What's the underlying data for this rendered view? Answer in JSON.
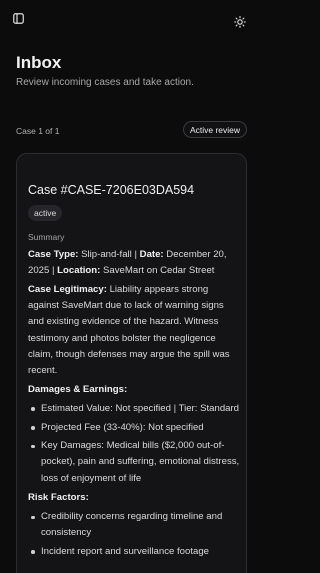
{
  "header": {
    "sidebar_icon": "sidebar-toggle-icon",
    "theme_icon": "sun-icon"
  },
  "page": {
    "title": "Inbox",
    "subtitle": "Review incoming cases and take action."
  },
  "pager": {
    "case_count": "Case 1 of 1",
    "active_review_label": "Active review"
  },
  "case": {
    "title": "Case #CASE-7206E03DA594",
    "status": "active",
    "summary_label": "Summary",
    "case_type_label": "Case Type:",
    "case_type": " Slip-and-fall | ",
    "date_label": "Date:",
    "date": " December 20, 2025 | ",
    "location_label": "Location:",
    "location": " SaveMart on Cedar Street",
    "legitimacy_label": "Case Legitimacy:",
    "legitimacy": " Liability appears strong against SaveMart due to lack of warning signs and existing evidence of the hazard. Witness testimony and photos bolster the negligence claim, though defenses may argue the spill was recent.",
    "damages_heading": "Damages & Earnings:",
    "damages": [
      "Estimated Value: Not specified | Tier: Standard",
      "Projected Fee (33-40%): Not specified",
      "Key Damages: Medical bills ($2,000 out-of-pocket), pain and suffering, emotional distress, loss of enjoyment of life"
    ],
    "risk_heading": "Risk Factors:",
    "risks": [
      "Credibility concerns regarding timeline and consistency",
      "Incident report and surveillance footage"
    ]
  },
  "colors": {
    "background": "#0c0c0d",
    "card": "#141416",
    "border": "#2d2d30"
  }
}
